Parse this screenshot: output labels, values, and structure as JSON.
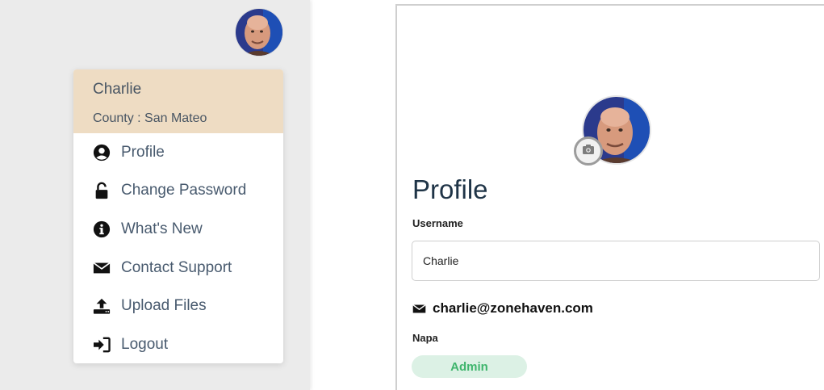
{
  "user_menu": {
    "name": "Charlie",
    "county": "County : San Mateo",
    "items": [
      {
        "label": "Profile",
        "icon": "user-circle-icon"
      },
      {
        "label": "Change Password",
        "icon": "unlock-icon"
      },
      {
        "label": "What's New",
        "icon": "info-circle-icon"
      },
      {
        "label": "Contact Support",
        "icon": "envelope-icon"
      },
      {
        "label": "Upload Files",
        "icon": "upload-icon"
      },
      {
        "label": "Logout",
        "icon": "sign-out-icon"
      }
    ]
  },
  "profile": {
    "title": "Profile",
    "username_label": "Username",
    "username_value": "Charlie",
    "email": "charlie@zonehaven.com",
    "county": "Napa",
    "role": "Admin"
  },
  "colors": {
    "menu_header_bg": "#eedcc3",
    "menu_text": "#485a6e",
    "role_badge_bg": "#dcf1e5",
    "role_badge_text": "#3eb56c",
    "title_text": "#1f3447"
  }
}
